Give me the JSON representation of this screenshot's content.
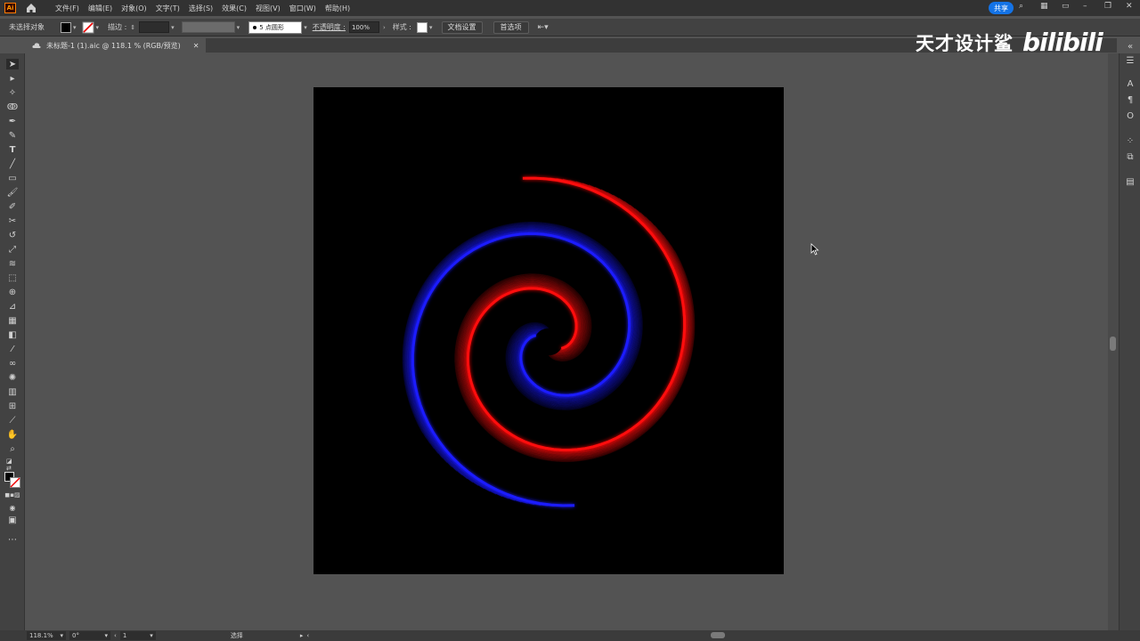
{
  "app": {
    "logo_text": "Ai"
  },
  "menu": {
    "items": [
      "文件(F)",
      "编辑(E)",
      "对象(O)",
      "文字(T)",
      "选择(S)",
      "效果(C)",
      "视图(V)",
      "窗口(W)",
      "帮助(H)"
    ]
  },
  "header": {
    "share_label": "共享"
  },
  "control": {
    "no_selection": "未选择对象",
    "stroke_label": "描边 :",
    "brush_label": "5 点圆形",
    "opacity_label": "不透明度 :",
    "opacity_value": "100%",
    "style_label": "样式 :",
    "doc_setup": "文档设置",
    "preferences": "首选项"
  },
  "document": {
    "tab_title": "未标题-1 (1).aic @ 118.1 % (RGB/预览)"
  },
  "status": {
    "zoom": "118.1%",
    "angle": "0°",
    "artboard": "1",
    "tool_name": "选择"
  },
  "watermark": {
    "text": "天才设计鲨",
    "bili": "bilibili"
  },
  "colors": {
    "spiral_blue": "#1a1aff",
    "spiral_red": "#ff1010",
    "artboard": "#000000",
    "accent": "#1473e6"
  }
}
